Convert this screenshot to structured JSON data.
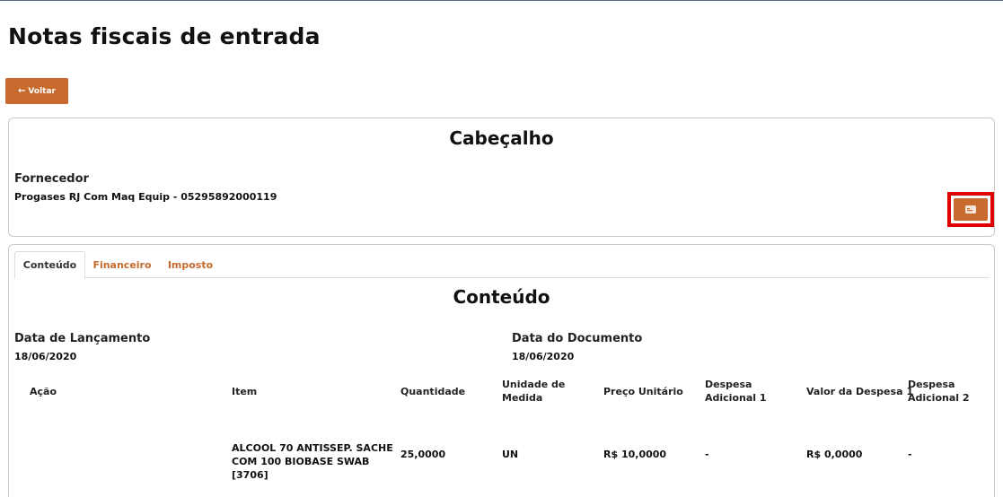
{
  "page": {
    "title": "Notas fiscais de entrada",
    "back_label": "Voltar"
  },
  "header_card": {
    "title": "Cabeçalho",
    "supplier_label": "Fornecedor",
    "supplier_value": "Progases RJ Com Maq Equip - 05295892000119"
  },
  "tabs": [
    {
      "label": "Conteúdo",
      "active": true
    },
    {
      "label": "Financeiro",
      "active": false
    },
    {
      "label": "Imposto",
      "active": false
    }
  ],
  "content": {
    "title": "Conteúdo",
    "launch_date_label": "Data de Lançamento",
    "launch_date_value": "18/06/2020",
    "doc_date_label": "Data do Documento",
    "doc_date_value": "18/06/2020"
  },
  "table": {
    "columns": [
      "Ação",
      "Item",
      "Quantidade",
      "Unidade de Medida",
      "Preço Unitário",
      "Despesa Adicional 1",
      "Valor da Despesa 1",
      "Despesa Adicional 2"
    ],
    "rows": [
      {
        "acao": "",
        "item": "ALCOOL 70 ANTISSEP. SACHE COM 100 BIOBASE SWAB [3706]",
        "quantidade": "25,0000",
        "unidade": "UN",
        "preco": "R$ 10,0000",
        "despesa1": "-",
        "valor_despesa1": "R$ 0,0000",
        "despesa2": "-"
      }
    ]
  },
  "icons": {
    "back": "arrow-left-icon",
    "id_card": "id-card-icon"
  },
  "colors": {
    "accent": "#c8692e",
    "highlight": "#e00000"
  }
}
